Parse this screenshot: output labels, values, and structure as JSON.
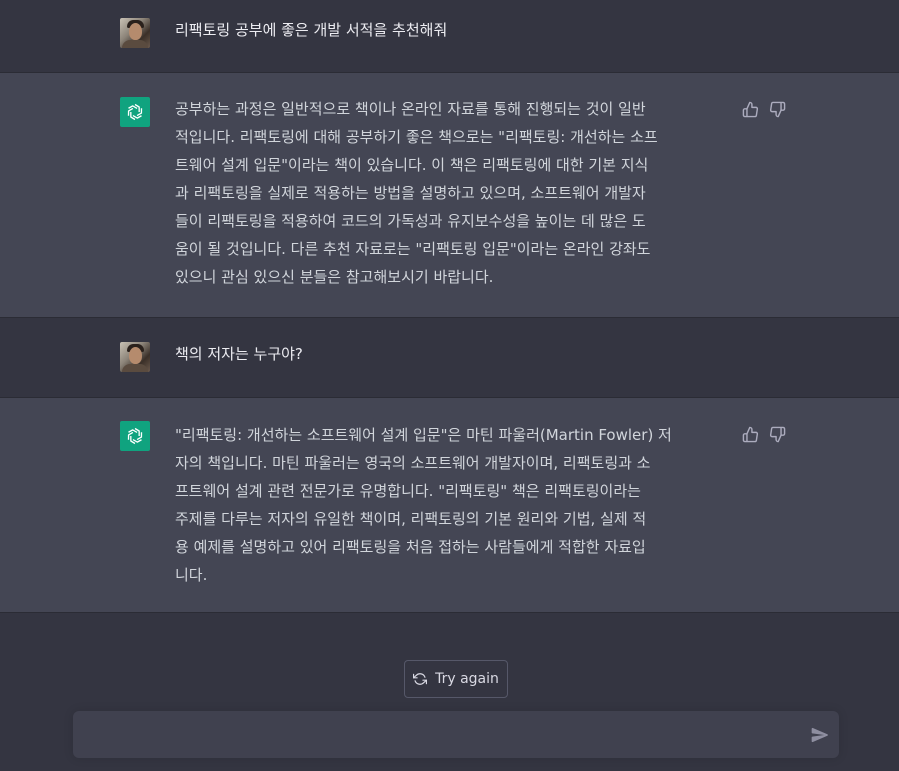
{
  "conversation": [
    {
      "role": "user",
      "text": "리팩토링 공부에 좋은 개발 서적을 추천해줘"
    },
    {
      "role": "assistant",
      "text": "공부하는 과정은 일반적으로 책이나 온라인 자료를 통해 진행되는 것이 일반\n적입니다. 리팩토링에 대해 공부하기 좋은 책으로는 \"리팩토링: 개선하는 소프\n트웨어 설계 입문\"이라는 책이 있습니다. 이 책은 리팩토링에 대한 기본 지식\n과 리팩토링을 실제로 적용하는 방법을 설명하고 있으며, 소프트웨어 개발자\n들이 리팩토링을 적용하여 코드의 가독성과 유지보수성을 높이는 데 많은 도\n움이 될 것입니다. 다른 추천 자료로는 \"리팩토링 입문\"이라는 온라인 강좌도\n있으니 관심 있으신 분들은 참고해보시기 바랍니다."
    },
    {
      "role": "user",
      "text": "책의 저자는 누구야?"
    },
    {
      "role": "assistant",
      "text": "\"리팩토링: 개선하는 소프트웨어 설계 입문\"은 마틴 파울러(Martin Fowler) 저\n자의 책입니다. 마틴 파울러는 영국의 소프트웨어 개발자이며, 리팩토링과 소\n프트웨어 설계 관련 전문가로 유명합니다. \"리팩토링\" 책은 리팩토링이라는\n주제를 다루는 저자의 유일한 책이며, 리팩토링의 기본 원리와 기법, 실제 적\n용 예제를 설명하고 있어 리팩토링을 처음 접하는 사람들에게 적합한 자료입\n니다."
    }
  ],
  "try_again_label": "Try again",
  "composer": {
    "placeholder": ""
  },
  "icons": {
    "assistant_avatar": "openai-logo-icon",
    "like": "thumbs-up-icon",
    "dislike": "thumbs-down-icon",
    "retry": "refresh-icon",
    "send": "paper-plane-icon"
  },
  "colors": {
    "background": "#343541",
    "assistant_row": "#444654",
    "accent": "#10a37f",
    "composer": "#40414f"
  }
}
